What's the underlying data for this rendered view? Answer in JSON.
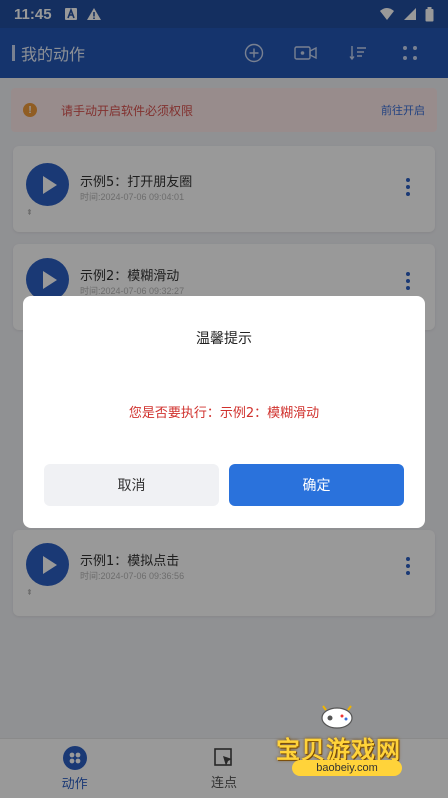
{
  "status_bar": {
    "time": "11:45"
  },
  "app_bar": {
    "title": "我的动作"
  },
  "alert": {
    "message": "请手动开启软件必须权限",
    "link": "前往开启",
    "warn_symbol": "!"
  },
  "actions": [
    {
      "name": "示例5：打开朋友圈",
      "time": "时间:2024-07-06 09:04:01"
    },
    {
      "name": "示例2：模糊滑动",
      "time": "时间:2024-07-06 09:32:27"
    },
    {
      "name": "示例1：模拟点击",
      "time": "时间:2024-07-06 09:36:56"
    }
  ],
  "pin_symbol": "⇞",
  "dialog": {
    "title": "温馨提示",
    "message": "您是否要执行：示例2：模糊滑动",
    "cancel_label": "取消",
    "confirm_label": "确定"
  },
  "tabbar": {
    "tabs": [
      {
        "label": "动作",
        "active": true
      },
      {
        "label": "连点",
        "active": false
      }
    ]
  },
  "watermark": {
    "text": "宝贝游戏网",
    "domain": "baobeiy.com"
  },
  "colors": {
    "primary": "#2458b6",
    "accent": "#2c5fc4",
    "confirm": "#2a72dc",
    "danger": "#d0312d"
  }
}
